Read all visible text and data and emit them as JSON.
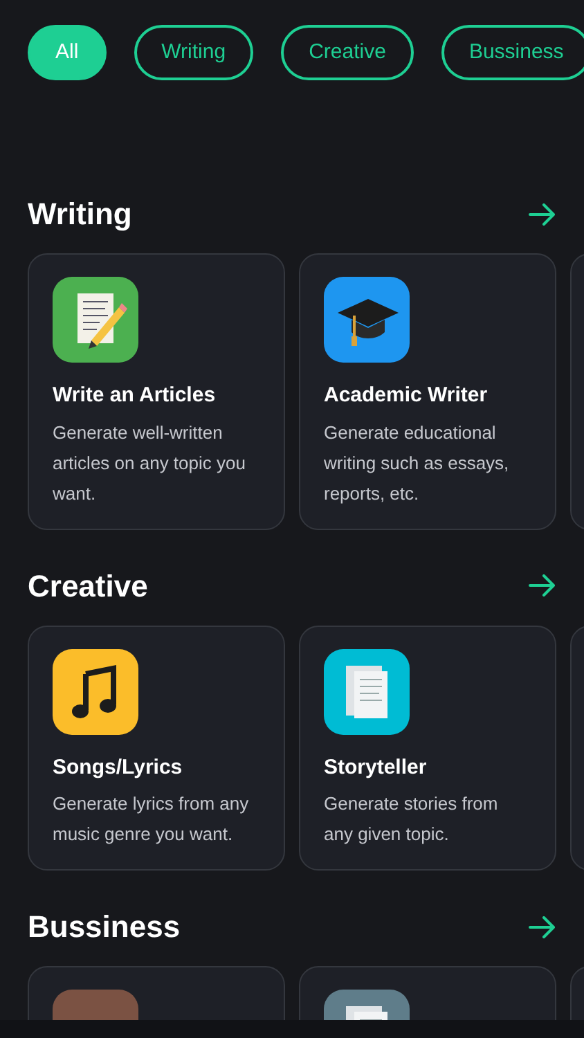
{
  "filters": [
    {
      "label": "All",
      "selected": true
    },
    {
      "label": "Writing",
      "selected": false
    },
    {
      "label": "Creative",
      "selected": false
    },
    {
      "label": "Bussiness",
      "selected": false
    }
  ],
  "sections": [
    {
      "title": "Writing",
      "cards": [
        {
          "kind": "notepad",
          "color": "#4cb050",
          "title": "Write an Articles",
          "description": "Generate well-written articles on any topic you want."
        },
        {
          "kind": "cap",
          "color": "#1e96f0",
          "title": "Academic Writer",
          "description": "Generate educational writing such as essays, reports, etc."
        },
        {
          "kind": "blank"
        }
      ]
    },
    {
      "title": "Creative",
      "cards": [
        {
          "kind": "music",
          "color": "#fbbd2a",
          "title": "Songs/Lyrics",
          "description": "Generate lyrics from any music genre you want."
        },
        {
          "kind": "document",
          "color": "#00bcd4",
          "title": "Storyteller",
          "description": "Generate stories from any given topic."
        },
        {
          "kind": "blank"
        }
      ]
    },
    {
      "title": "Bussiness",
      "cards": [
        {
          "kind": "plain",
          "color": "#7b5243"
        },
        {
          "kind": "document",
          "color": "#5f7d8a"
        },
        {
          "kind": "blank"
        }
      ]
    }
  ]
}
